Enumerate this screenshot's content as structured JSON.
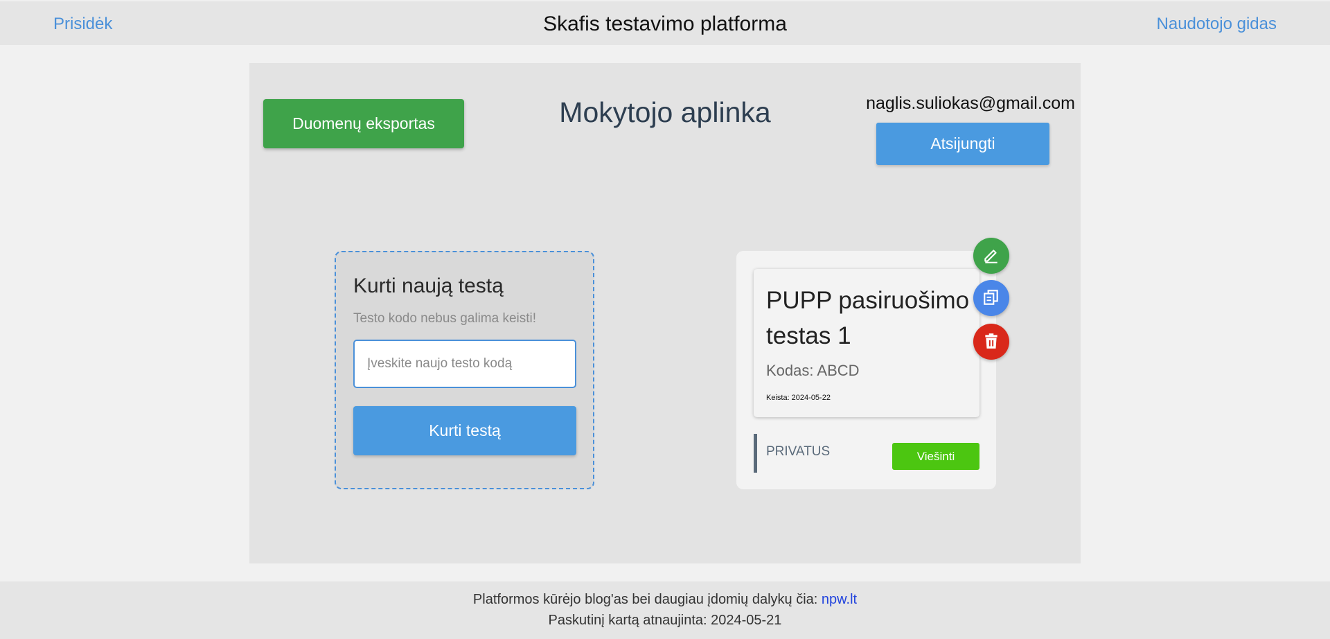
{
  "header": {
    "left_link": "Prisidėk",
    "title": "Skafis testavimo platforma",
    "right_link": "Naudotojo gidas"
  },
  "panel": {
    "export_button": "Duomenų eksportas",
    "title": "Mokytojo aplinka",
    "user_email": "naglis.suliokas@gmail.com",
    "logout_button": "Atsijungti"
  },
  "create_card": {
    "heading": "Kurti naują testą",
    "note": "Testo kodo nebus galima keisti!",
    "input_placeholder": "Įveskite naujo testo kodą",
    "input_value": "",
    "create_button": "Kurti testą"
  },
  "test_card": {
    "name": "PUPP pasiruošimo testas 1",
    "code": "Kodas: ABCD",
    "modified": "Keista: 2024-05-22",
    "status": "PRIVATUS",
    "publish_button": "Viešinti",
    "actions": [
      {
        "icon": "pencil-icon",
        "color": "#3fa34a"
      },
      {
        "icon": "copy-icon",
        "color": "#4a86e8"
      },
      {
        "icon": "trash-icon",
        "color": "#d9281a"
      }
    ]
  },
  "footer": {
    "line1_text": "Platformos kūrėjo blog'as bei daugiau įdomių dalykų čia: ",
    "line1_link": "npw.lt",
    "line2": "Paskutinį kartą atnaujinta: 2024-05-21"
  },
  "colors": {
    "link": "#4a90d9",
    "primary_button": "#4a9ae0",
    "success_button": "#3fa34a",
    "publish_button": "#4cc611",
    "danger": "#d9281a"
  }
}
